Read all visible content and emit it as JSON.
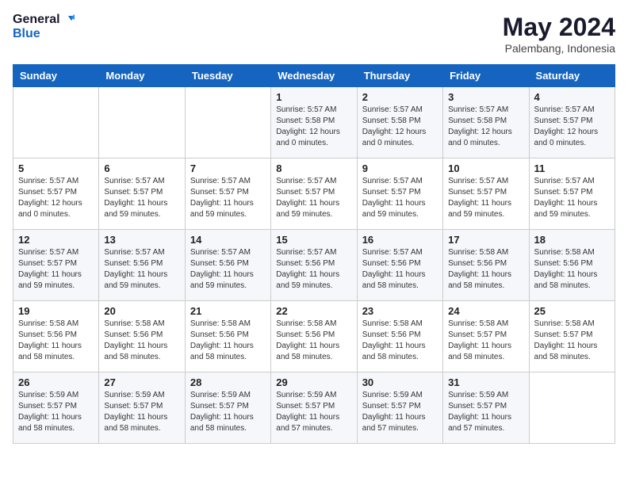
{
  "header": {
    "logo_line1": "General",
    "logo_line2": "Blue",
    "month": "May 2024",
    "location": "Palembang, Indonesia"
  },
  "days_of_week": [
    "Sunday",
    "Monday",
    "Tuesday",
    "Wednesday",
    "Thursday",
    "Friday",
    "Saturday"
  ],
  "weeks": [
    [
      {
        "day": "",
        "info": ""
      },
      {
        "day": "",
        "info": ""
      },
      {
        "day": "",
        "info": ""
      },
      {
        "day": "1",
        "info": "Sunrise: 5:57 AM\nSunset: 5:58 PM\nDaylight: 12 hours\nand 0 minutes."
      },
      {
        "day": "2",
        "info": "Sunrise: 5:57 AM\nSunset: 5:58 PM\nDaylight: 12 hours\nand 0 minutes."
      },
      {
        "day": "3",
        "info": "Sunrise: 5:57 AM\nSunset: 5:58 PM\nDaylight: 12 hours\nand 0 minutes."
      },
      {
        "day": "4",
        "info": "Sunrise: 5:57 AM\nSunset: 5:57 PM\nDaylight: 12 hours\nand 0 minutes."
      }
    ],
    [
      {
        "day": "5",
        "info": "Sunrise: 5:57 AM\nSunset: 5:57 PM\nDaylight: 12 hours\nand 0 minutes."
      },
      {
        "day": "6",
        "info": "Sunrise: 5:57 AM\nSunset: 5:57 PM\nDaylight: 11 hours\nand 59 minutes."
      },
      {
        "day": "7",
        "info": "Sunrise: 5:57 AM\nSunset: 5:57 PM\nDaylight: 11 hours\nand 59 minutes."
      },
      {
        "day": "8",
        "info": "Sunrise: 5:57 AM\nSunset: 5:57 PM\nDaylight: 11 hours\nand 59 minutes."
      },
      {
        "day": "9",
        "info": "Sunrise: 5:57 AM\nSunset: 5:57 PM\nDaylight: 11 hours\nand 59 minutes."
      },
      {
        "day": "10",
        "info": "Sunrise: 5:57 AM\nSunset: 5:57 PM\nDaylight: 11 hours\nand 59 minutes."
      },
      {
        "day": "11",
        "info": "Sunrise: 5:57 AM\nSunset: 5:57 PM\nDaylight: 11 hours\nand 59 minutes."
      }
    ],
    [
      {
        "day": "12",
        "info": "Sunrise: 5:57 AM\nSunset: 5:57 PM\nDaylight: 11 hours\nand 59 minutes."
      },
      {
        "day": "13",
        "info": "Sunrise: 5:57 AM\nSunset: 5:56 PM\nDaylight: 11 hours\nand 59 minutes."
      },
      {
        "day": "14",
        "info": "Sunrise: 5:57 AM\nSunset: 5:56 PM\nDaylight: 11 hours\nand 59 minutes."
      },
      {
        "day": "15",
        "info": "Sunrise: 5:57 AM\nSunset: 5:56 PM\nDaylight: 11 hours\nand 59 minutes."
      },
      {
        "day": "16",
        "info": "Sunrise: 5:57 AM\nSunset: 5:56 PM\nDaylight: 11 hours\nand 58 minutes."
      },
      {
        "day": "17",
        "info": "Sunrise: 5:58 AM\nSunset: 5:56 PM\nDaylight: 11 hours\nand 58 minutes."
      },
      {
        "day": "18",
        "info": "Sunrise: 5:58 AM\nSunset: 5:56 PM\nDaylight: 11 hours\nand 58 minutes."
      }
    ],
    [
      {
        "day": "19",
        "info": "Sunrise: 5:58 AM\nSunset: 5:56 PM\nDaylight: 11 hours\nand 58 minutes."
      },
      {
        "day": "20",
        "info": "Sunrise: 5:58 AM\nSunset: 5:56 PM\nDaylight: 11 hours\nand 58 minutes."
      },
      {
        "day": "21",
        "info": "Sunrise: 5:58 AM\nSunset: 5:56 PM\nDaylight: 11 hours\nand 58 minutes."
      },
      {
        "day": "22",
        "info": "Sunrise: 5:58 AM\nSunset: 5:56 PM\nDaylight: 11 hours\nand 58 minutes."
      },
      {
        "day": "23",
        "info": "Sunrise: 5:58 AM\nSunset: 5:56 PM\nDaylight: 11 hours\nand 58 minutes."
      },
      {
        "day": "24",
        "info": "Sunrise: 5:58 AM\nSunset: 5:57 PM\nDaylight: 11 hours\nand 58 minutes."
      },
      {
        "day": "25",
        "info": "Sunrise: 5:58 AM\nSunset: 5:57 PM\nDaylight: 11 hours\nand 58 minutes."
      }
    ],
    [
      {
        "day": "26",
        "info": "Sunrise: 5:59 AM\nSunset: 5:57 PM\nDaylight: 11 hours\nand 58 minutes."
      },
      {
        "day": "27",
        "info": "Sunrise: 5:59 AM\nSunset: 5:57 PM\nDaylight: 11 hours\nand 58 minutes."
      },
      {
        "day": "28",
        "info": "Sunrise: 5:59 AM\nSunset: 5:57 PM\nDaylight: 11 hours\nand 58 minutes."
      },
      {
        "day": "29",
        "info": "Sunrise: 5:59 AM\nSunset: 5:57 PM\nDaylight: 11 hours\nand 57 minutes."
      },
      {
        "day": "30",
        "info": "Sunrise: 5:59 AM\nSunset: 5:57 PM\nDaylight: 11 hours\nand 57 minutes."
      },
      {
        "day": "31",
        "info": "Sunrise: 5:59 AM\nSunset: 5:57 PM\nDaylight: 11 hours\nand 57 minutes."
      },
      {
        "day": "",
        "info": ""
      }
    ]
  ]
}
